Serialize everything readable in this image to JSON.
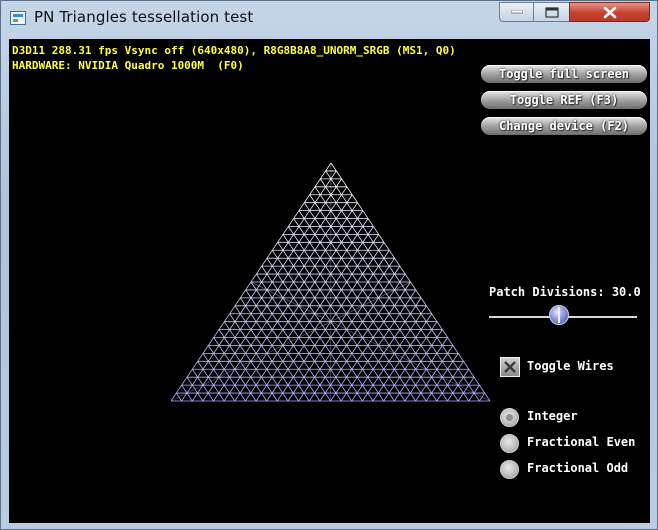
{
  "window": {
    "title": "PN Triangles tessellation test",
    "controls": [
      "minimize-icon",
      "maximize-icon",
      "close-icon"
    ]
  },
  "stats": {
    "line1": "D3D11 288.31 fps Vsync off (640x480), R8G8B8A8_UNORM_SRGB (MS1, Q0)",
    "line2": "HARDWARE: NVIDIA Quadro 1000M  (F0)"
  },
  "buttons": {
    "toggle_full_screen": "Toggle full screen",
    "toggle_ref": "Toggle REF (F3)",
    "change_device": "Change device (F2)"
  },
  "patch": {
    "label": "Patch Divisions: 30.0",
    "value": 30.0,
    "slider_fraction": 0.47
  },
  "wires": {
    "label": "Toggle Wires",
    "checked": true
  },
  "partitioning": {
    "options": [
      "Integer",
      "Fractional Even",
      "Fractional Odd"
    ],
    "selected": "Integer"
  },
  "mesh": {
    "divisions": 30,
    "color_top": "#ffffff",
    "color_bottom": "#aaaaff"
  },
  "colors": {
    "stats_text": "#ffff3a",
    "viewport_bg": "#000000",
    "close_button": "#c6422f"
  }
}
